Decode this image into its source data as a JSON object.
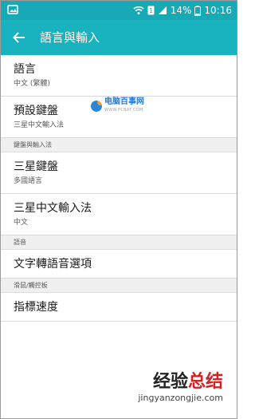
{
  "status_bar": {
    "battery": "14%",
    "time": "10:16",
    "icons": [
      "image-icon",
      "wifi-icon",
      "sim-icon",
      "signal-icon",
      "battery-icon"
    ]
  },
  "app_bar": {
    "title": "語言與輸入",
    "back_icon": "back-arrow-icon"
  },
  "items": [
    {
      "primary": "語言",
      "secondary": "中文 (繁體)"
    },
    {
      "primary": "預設鍵盤",
      "secondary": "三星中文輸入法"
    }
  ],
  "sections": [
    {
      "header": "鍵盤與輸入法",
      "items": [
        {
          "primary": "三星鍵盤",
          "secondary": "多國語言"
        },
        {
          "primary": "三星中文輸入法",
          "secondary": "中文"
        }
      ]
    },
    {
      "header": "語音",
      "items": [
        {
          "primary": "文字轉語音選項"
        }
      ]
    },
    {
      "header": "滑鼠/觸控板",
      "items": [
        {
          "primary": "指標速度"
        }
      ]
    }
  ],
  "watermark": {
    "text": "电脑百事网",
    "sub": "WWW.PCBAT.COM"
  },
  "footer_watermark": {
    "brand_black": "经验",
    "brand_red": "总结",
    "url": "jingyanzongjie.com"
  }
}
